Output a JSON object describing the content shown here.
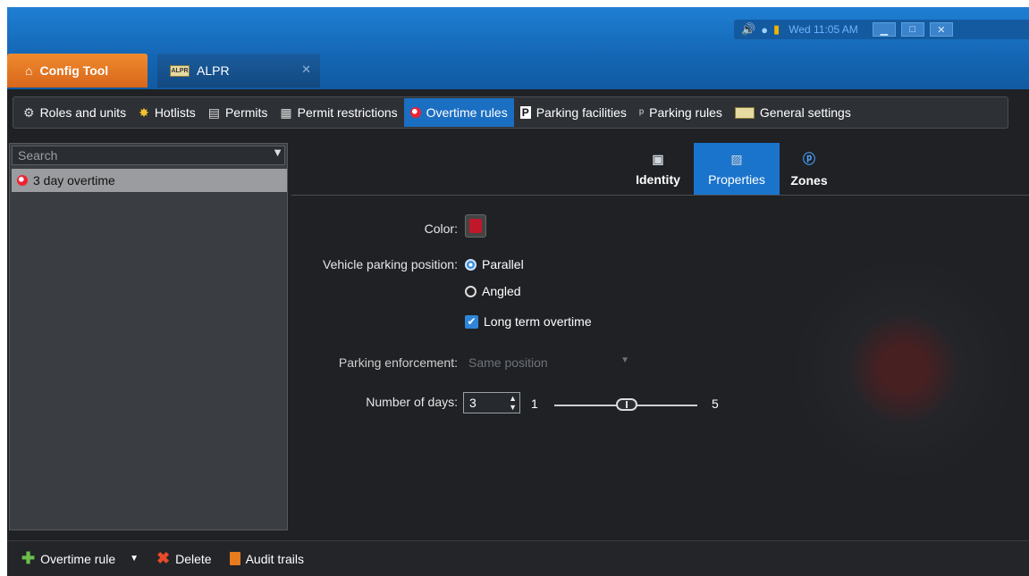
{
  "tray": {
    "time": "Wed 11:05 AM"
  },
  "tabs": {
    "config_tool": "Config Tool",
    "alpr": "ALPR",
    "alpr_plate": "ALPR"
  },
  "modules": [
    {
      "label": "Roles and units",
      "icon": "roles-icon"
    },
    {
      "label": "Hotlists",
      "icon": "star-icon"
    },
    {
      "label": "Permits",
      "icon": "permit-icon"
    },
    {
      "label": "Permit restrictions",
      "icon": "permit-restriction-icon"
    },
    {
      "label": "Overtime rules",
      "icon": "overtime-icon",
      "active": true
    },
    {
      "label": "Parking facilities",
      "icon": "parking-p-icon"
    },
    {
      "label": "Parking rules",
      "icon": "parking-rules-icon"
    },
    {
      "label": "General settings",
      "icon": "settings-plate-icon"
    }
  ],
  "left": {
    "search_placeholder": "Search",
    "items": [
      "3 day overtime"
    ]
  },
  "subtabs": [
    {
      "label": "Identity",
      "icon": "identity-icon"
    },
    {
      "label": "Properties",
      "icon": "properties-icon",
      "active": true
    },
    {
      "label": "Zones",
      "icon": "zones-icon"
    }
  ],
  "form": {
    "color_label": "Color:",
    "color_value": "#c0172b",
    "position_label": "Vehicle parking position:",
    "parallel": "Parallel",
    "angled": "Angled",
    "selected_position": "Parallel",
    "long_term": "Long term overtime",
    "long_term_checked": true,
    "enforcement_label": "Parking enforcement:",
    "enforcement_value": "Same position",
    "days_label": "Number of days:",
    "days_value": "3",
    "slider_min": "1",
    "slider_max": "5",
    "slider_value": 3
  },
  "bottom": {
    "add": "Overtime rule",
    "delete": "Delete",
    "audit": "Audit trails"
  }
}
